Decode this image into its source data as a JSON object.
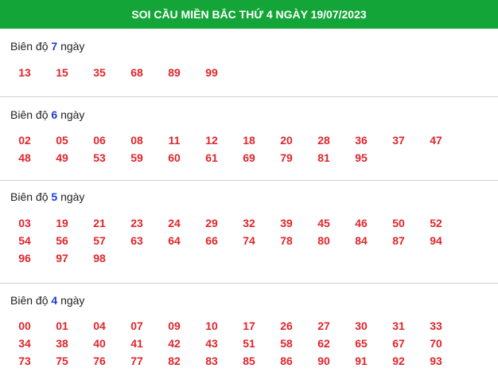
{
  "header": {
    "title": "SOI CẦU MIỀN BẮC THỨ 4 NGÀY 19/07/2023"
  },
  "colors": {
    "header_bg": "#14a538",
    "number": "#e0252b",
    "day_count": "#1a3fd6"
  },
  "sections": [
    {
      "label_prefix": "Biên độ",
      "days": "7",
      "label_suffix": "ngày",
      "numbers": [
        "13",
        "15",
        "35",
        "68",
        "89",
        "99"
      ]
    },
    {
      "label_prefix": "Biên độ",
      "days": "6",
      "label_suffix": "ngày",
      "numbers": [
        "02",
        "05",
        "06",
        "08",
        "11",
        "12",
        "18",
        "20",
        "28",
        "36",
        "37",
        "47",
        "48",
        "49",
        "53",
        "59",
        "60",
        "61",
        "69",
        "79",
        "81",
        "95"
      ]
    },
    {
      "label_prefix": "Biên độ",
      "days": "5",
      "label_suffix": "ngày",
      "numbers": [
        "03",
        "19",
        "21",
        "23",
        "24",
        "29",
        "32",
        "39",
        "45",
        "46",
        "50",
        "52",
        "54",
        "56",
        "57",
        "63",
        "64",
        "66",
        "74",
        "78",
        "80",
        "84",
        "87",
        "94",
        "96",
        "97",
        "98"
      ]
    },
    {
      "label_prefix": "Biên độ",
      "days": "4",
      "label_suffix": "ngày",
      "numbers": [
        "00",
        "01",
        "04",
        "07",
        "09",
        "10",
        "17",
        "26",
        "27",
        "30",
        "31",
        "33",
        "34",
        "38",
        "40",
        "41",
        "42",
        "43",
        "51",
        "58",
        "62",
        "65",
        "67",
        "70",
        "73",
        "75",
        "76",
        "77",
        "82",
        "83",
        "85",
        "86",
        "90",
        "91",
        "92",
        "93"
      ]
    }
  ]
}
